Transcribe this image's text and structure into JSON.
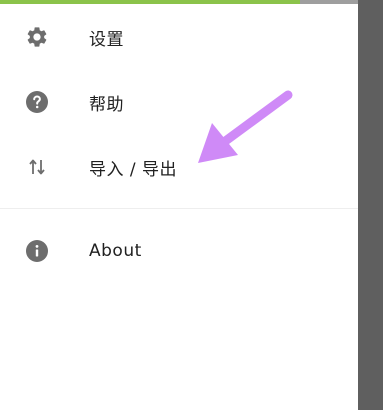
{
  "drawer": {
    "items": [
      {
        "label": "设置",
        "icon": "gear-icon"
      },
      {
        "label": "帮助",
        "icon": "help-circle-icon"
      },
      {
        "label": "导入 / 导出",
        "icon": "import-export-icon"
      },
      {
        "label": "About",
        "icon": "info-circle-icon"
      }
    ]
  },
  "colors": {
    "accent_green": "#8bc34a",
    "icon_gray": "#6d6d6d",
    "annotation_arrow": "#cf8af7",
    "scrim": "#5f5f5f"
  }
}
